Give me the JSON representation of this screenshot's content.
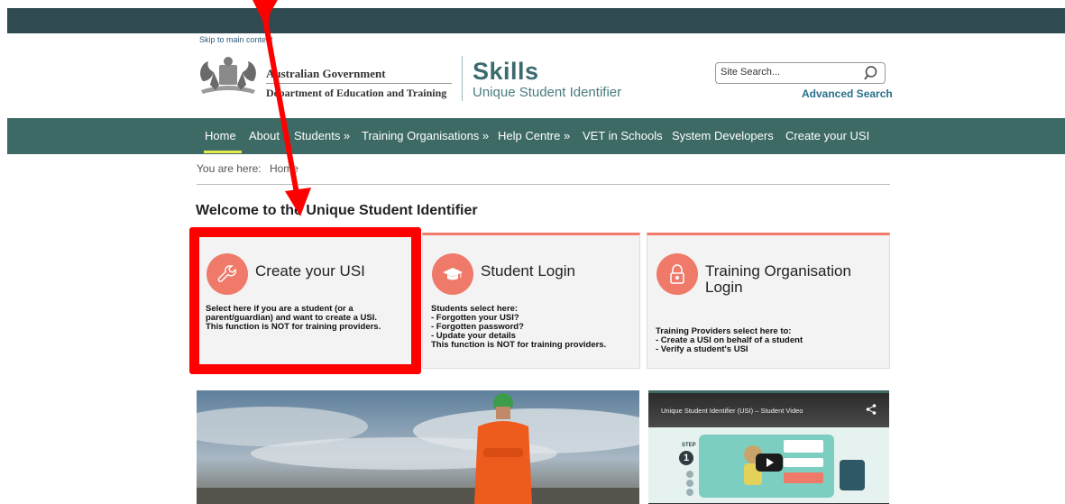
{
  "header": {
    "skip_link": "Skip to main content",
    "gov_line1": "Australian Government",
    "gov_line2": "Department of Education and Training",
    "brand_title": "Skills",
    "brand_subtitle": "Unique Student Identifier",
    "search_placeholder": "Site Search...",
    "advanced_search": "Advanced Search"
  },
  "nav": {
    "items": [
      "Home",
      "About",
      "Students »",
      "Training Organisations »",
      "Help Centre »",
      "VET in Schools",
      "System Developers",
      "Create your USI"
    ]
  },
  "breadcrumb": {
    "prefix": "You are here:",
    "current": "Home"
  },
  "main": {
    "welcome": "Welcome to the Unique Student Identifier",
    "cards": [
      {
        "title": "Create your USI",
        "icon": "wrench-icon",
        "description": "Select here if you are a student (or a\nparent/guardian) and want to create a USI.\nThis function is NOT for training providers."
      },
      {
        "title": "Student Login",
        "icon": "graduation-cap-icon",
        "description": "Students select here:\n- Forgotten your USI?\n- Forgotten password?\n- Update your details\nThis function is NOT for training providers."
      },
      {
        "title": "Training Organisation Login",
        "icon": "padlock-icon",
        "description": "Training Providers select here to:\n- Create a USI on behalf of a student\n- Verify a student's USI"
      }
    ],
    "video_title": "Unique Student Identifier (USI) – Student Video",
    "video_step_label": "STEP",
    "video_step_number": "1"
  },
  "colors": {
    "topbar": "#2f4a51",
    "navbar": "#3d6a65",
    "accent": "#ef7a6a",
    "annotation": "#ff0000"
  }
}
